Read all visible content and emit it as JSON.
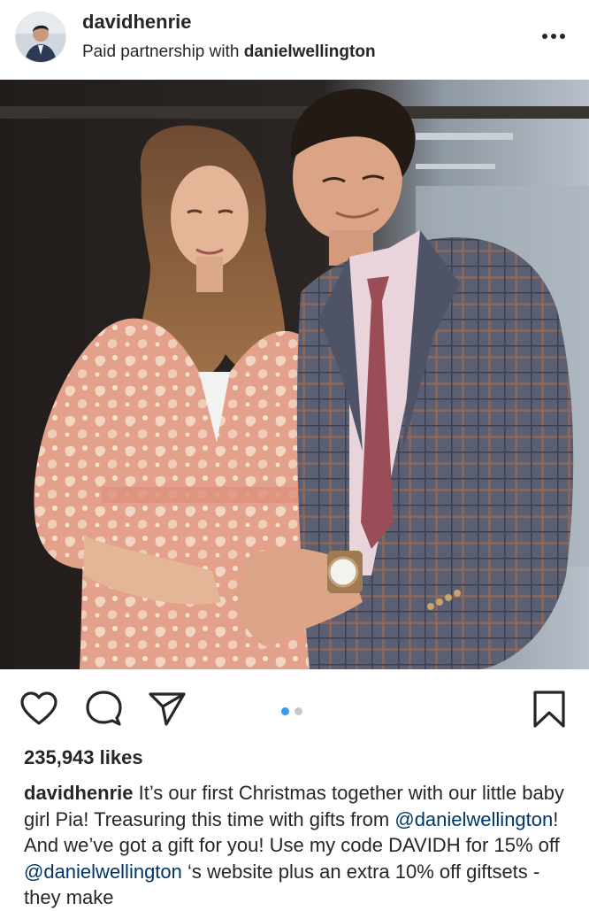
{
  "post": {
    "username": "davidhenrie",
    "subline_prefix": "Paid partnership with",
    "partner": "danielwellington",
    "more_icon": "more-horizontal-icon"
  },
  "actions": {
    "icons": [
      "heart-icon",
      "comment-icon",
      "share-icon",
      "bookmark-icon"
    ],
    "carousel_total": 2,
    "carousel_active": 1,
    "active_dot_color": "#3897f0",
    "inactive_dot_color": "#c7c7c7"
  },
  "likes": "235,943 likes",
  "caption": {
    "username": "davidhenrie",
    "part1": " It’s our first Christmas together with our little baby girl Pia! Treasuring this time with gifts from ",
    "mention1": "@danielwellington",
    "part2": "! And we’ve got a gift for you! Use my code DAVIDH for 15% off ",
    "mention2": "@danielwellington",
    "part3": " ‘s website plus an extra 10% off giftsets - they make"
  },
  "colors": {
    "text": "#262626",
    "mention": "#003569"
  }
}
